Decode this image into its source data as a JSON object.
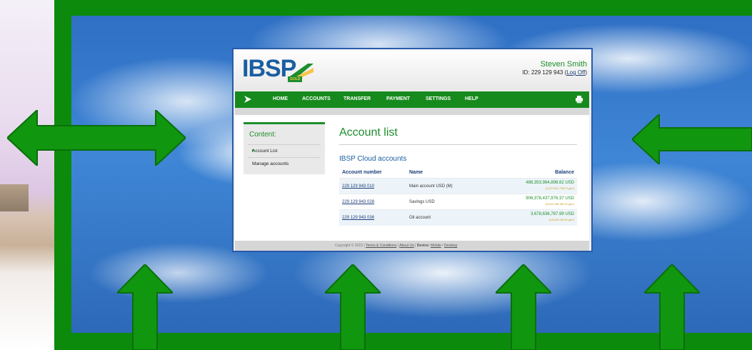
{
  "header": {
    "logo_text": "IBSP",
    "logo_tag": "GOLD",
    "user_name": "Steven Smith",
    "user_id_prefix": "ID: 229 129 943 (",
    "logoff_label": "Log Off",
    "user_id_suffix": ")"
  },
  "nav": {
    "items": [
      "HOME",
      "ACCOUNTS",
      "TRANSFER",
      "PAYMENT",
      "SETTINGS",
      "HELP"
    ],
    "icons": [
      "play-arrow-icon",
      "printer-icon"
    ]
  },
  "sidebar": {
    "title": "Content:",
    "items": [
      {
        "label": "Account List",
        "selected": true
      },
      {
        "label": "Manage accounts",
        "selected": false
      }
    ]
  },
  "main": {
    "title": "Account list",
    "section_title": "IBSP Cloud accounts",
    "columns": [
      "Account number",
      "Name",
      "Balance"
    ],
    "rows": [
      {
        "account": "229 129 943 010",
        "name": "Main account USD (M)",
        "balance": "488,353,984,898.82 USD",
        "sub": "(13,274,817,738.73 gAU)"
      },
      {
        "account": "229 129 943 028",
        "name": "Savings USD",
        "balance": "906,378,437,976.37 USD",
        "sub": "(24,637,982,969.32 gAU)"
      },
      {
        "account": "229 129 943 036",
        "name": "Oil account",
        "balance": "3,678,636,787.99 USD",
        "sub": "(100,001,000.00 gAU)"
      }
    ]
  },
  "footer": {
    "copyright": "Copyright © 2015 | ",
    "terms": "Terms & Conditions",
    "sep1": " | ",
    "about": "About Us",
    "sep2": " | ",
    "device_label": "Device:",
    "mobile": "Mobile",
    "slash": " / ",
    "desktop": "Desktop"
  },
  "colors": {
    "frame_green": "#0c8a0c",
    "nav_green": "#178a1e",
    "brand_blue": "#1b5ea0",
    "sky_blue": "#3f86d6"
  }
}
